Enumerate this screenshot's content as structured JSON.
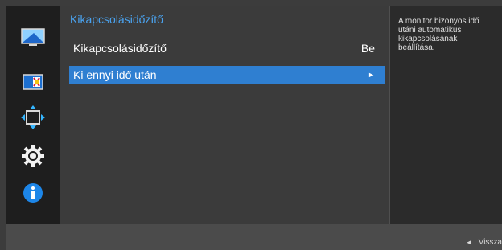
{
  "sidebar": {
    "items": [
      {
        "icon": "monitor-picture-icon"
      },
      {
        "icon": "color-icon"
      },
      {
        "icon": "screen-size-icon"
      },
      {
        "icon": "system-gear-icon"
      },
      {
        "icon": "information-icon"
      }
    ]
  },
  "menu": {
    "title": "Kikapcsolásidőzítő",
    "items": [
      {
        "label": "Kikapcsolásidőzítő",
        "value": "Be"
      },
      {
        "label": "Ki ennyi idő után",
        "value": "►"
      }
    ]
  },
  "help": {
    "lines": [
      "A monitor bizonyos idő",
      "utáni automatikus",
      "kikapcsolásának",
      "beállítása."
    ]
  },
  "footer": {
    "back_label": "Vissza",
    "back_icon": "◄"
  },
  "colors": {
    "accent": "#2f7fd1",
    "title": "#4aa3f0"
  }
}
